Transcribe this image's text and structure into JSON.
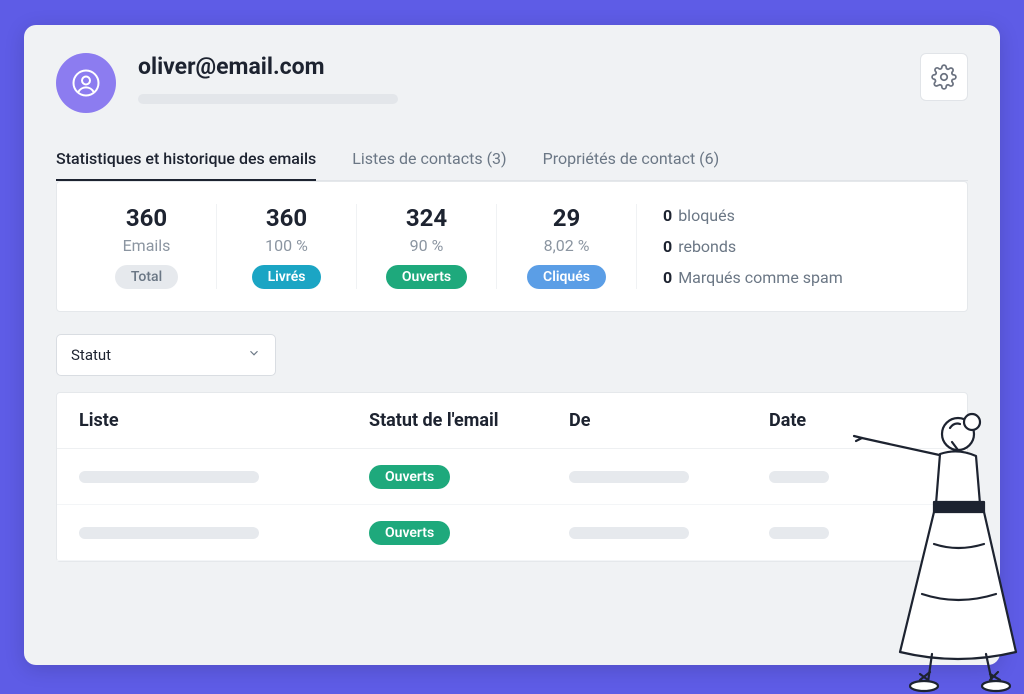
{
  "header": {
    "email": "oliver@email.com"
  },
  "tabs": [
    {
      "label": "Statistiques et historique des emails",
      "active": true
    },
    {
      "label": "Listes de contacts (3)",
      "active": false
    },
    {
      "label": "Propriétés de contact (6)",
      "active": false
    }
  ],
  "stats": {
    "emails": {
      "value": "360",
      "sub": "Emails",
      "pill": "Total"
    },
    "delivered": {
      "value": "360",
      "sub": "100 %",
      "pill": "Livrés"
    },
    "opened": {
      "value": "324",
      "sub": "90 %",
      "pill": "Ouverts"
    },
    "clicked": {
      "value": "29",
      "sub": "8,02 %",
      "pill": "Cliqués"
    }
  },
  "zeros": {
    "blocked": {
      "n": "0",
      "label": "bloqués"
    },
    "bounces": {
      "n": "0",
      "label": "rebonds"
    },
    "spam": {
      "n": "0",
      "label": "Marqués comme spam"
    }
  },
  "filter": {
    "label": "Statut"
  },
  "table": {
    "headers": {
      "list": "Liste",
      "status": "Statut de l'email",
      "from": "De",
      "date": "Date"
    },
    "rows": [
      {
        "status_pill": "Ouverts"
      },
      {
        "status_pill": "Ouverts"
      }
    ]
  },
  "colors": {
    "gray_pill": "#e6e9ed",
    "teal_pill": "#1ba5c4",
    "green_pill": "#1ea97c",
    "blue_pill": "#5b9ee6",
    "accent": "#8c7cf0",
    "border_purple": "#5e5ce6"
  }
}
